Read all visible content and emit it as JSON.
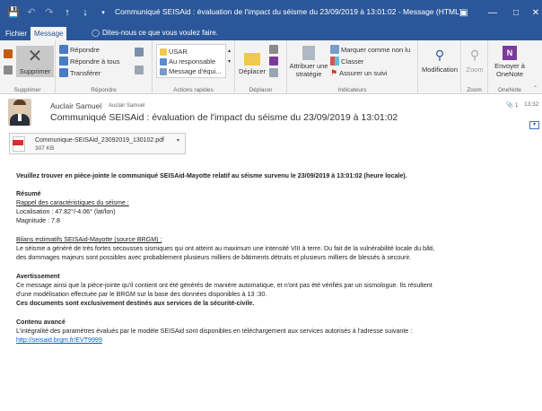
{
  "window": {
    "title": "Communiqué SEISAid : évaluation de l'impact du séisme du 23/09/2019 à 13:01:02 - Message (HTML)",
    "accent": "#2b579a"
  },
  "tabs": [
    {
      "label": "Fichier"
    },
    {
      "label": "Message"
    }
  ],
  "tell_me": "Dites-nous ce que vous voulez faire.",
  "ribbon": {
    "delete_label": "Supprimer",
    "group_delete": "Supprimer",
    "reply": "Répondre",
    "reply_all": "Répondre à tous",
    "forward": "Transférer",
    "group_respond": "Répondre",
    "quick_steps": [
      "USAR",
      "Au responsable",
      "Message d'équi..."
    ],
    "group_quick": "Actions rapides",
    "move": "Déplacer",
    "group_move": "Déplacer",
    "assign_line1": "Attribuer une",
    "assign_line2": "stratégie",
    "mark_unread": "Marquer comme non lu",
    "categorize": "Classer",
    "follow_up": "Assurer un suivi",
    "group_tags": "Indicateurs",
    "edit": "Modification",
    "zoom": "Zoom",
    "group_zoom": "Zoom",
    "onenote_line1": "Envoyer à",
    "onenote_line2": "OneNote",
    "group_onenote": "OneNote"
  },
  "header": {
    "sender": "Auclair Samuel",
    "to": "Auclair Samuel",
    "subject": "Communiqué SEISAid : évaluation de l'impact du séisme du 23/09/2019 à 13:01:02",
    "attachment_count": "1",
    "time": "13:32"
  },
  "attachment": {
    "name": "Communique-SEISAid_23092019_130102.pdf",
    "size": "307 KB"
  },
  "body": {
    "intro": "Veuillez trouver en pièce-jointe le communiqué SEISAid-Mayotte relatif au séisme survenu le 23/09/2019 à 13:01:02 (heure locale).",
    "resume_title": "Résumé",
    "rappel_title": "Rappel des caractéristiques du séisme :",
    "localisation": "Localisation : 47.82°/-4.06° (lat/lon)",
    "magnitude": "Magnitude : 7.8",
    "bilans_title": "Bilans estimatifs SEISAid-Mayotte (source BRGM) :",
    "bilans_line1": "Le séisme a généré de très fortes secousses sismiques qui ont atteint au maximum une intensité VIII à terre. Du fait de la vulnérabilité locale du bâti,",
    "bilans_line2": "des dommages majeurs sont possibles avec probablement plusieurs milliers de bâtiments détruits et plusieurs milliers de blessés à secourir.",
    "avert_title": "Avertissement",
    "avert_line1": "Ce message ainsi que la pièce-jointe qu'il contient ont été générés de manière automatique, et n'ont pas été vérifiés par un sismologue. Ils résultent",
    "avert_line2": "d'une modélisation effectuée par le BRGM sur la base des données disponibles à 13 :30.",
    "avert_bold": "Ces documents sont exclusivement destinés aux services de la sécurité-civile.",
    "contenu_title": "Contenu avancé",
    "contenu_line": "L'intégralité des paramètres évalués par le modèle SEISAid sont disponibles en téléchargement aux services autorisés à l'adresse suivante :",
    "link": "http://seisaid.brgm.fr/EVT9999"
  }
}
